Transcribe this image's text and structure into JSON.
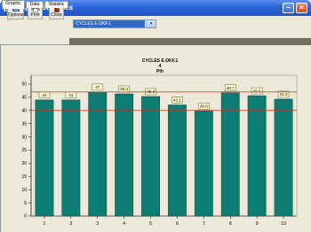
{
  "window": {
    "title": "Display Statistics",
    "minimize_glyph": "–",
    "close_glyph": "×"
  },
  "toolbar": {
    "options_label": "Options",
    "print_label": "Print",
    "close_label": "Close",
    "selector_value": "CYCLES E-DKF.1",
    "selector_arrow": "▼"
  },
  "tabs": [
    {
      "label": "Graphic",
      "active": true
    },
    {
      "label": "Data",
      "active": false
    },
    {
      "label": "Statistic",
      "active": false
    }
  ],
  "colors": {
    "bar": "#0e7c72",
    "bar_border": "#074b44",
    "limit_line": "#c0302a",
    "label_fill": "#ffffcc"
  },
  "chart_data": {
    "type": "bar",
    "title_lines": [
      "CYCLES E-DKF.1",
      "4",
      "Pth"
    ],
    "categories": [
      "1",
      "2",
      "3",
      "4",
      "5",
      "6",
      "7",
      "8",
      "9",
      "10"
    ],
    "values": [
      44,
      44,
      47,
      46.3,
      45.3,
      42.1,
      39.8,
      46.7,
      45.6,
      44.3
    ],
    "value_labels": [
      "44",
      "44",
      "47",
      "46.3",
      "45.3",
      "42.1",
      "39.8",
      "46.7",
      "45.6",
      "44.3"
    ],
    "y_ticks": [
      "0",
      "5",
      "10",
      "15",
      "20",
      "25",
      "30",
      "35",
      "40",
      "45",
      "50"
    ],
    "ylim": [
      0,
      52
    ],
    "reference_lines": [
      47,
      40
    ]
  }
}
